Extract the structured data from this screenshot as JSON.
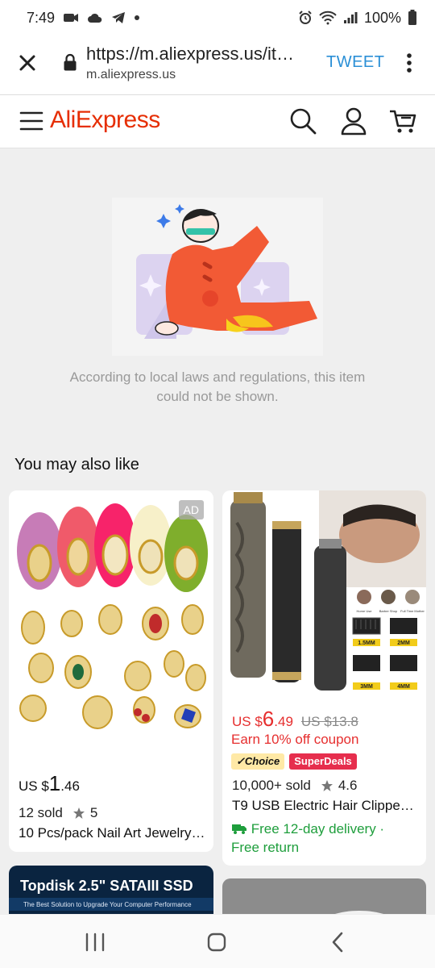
{
  "status_bar": {
    "time": "7:49",
    "battery": "100%"
  },
  "browser": {
    "url": "https://m.aliexpress.us/it…",
    "domain": "m.aliexpress.us",
    "action": "TWEET"
  },
  "header": {
    "logo": "AliExpress"
  },
  "notice": {
    "text": "According to local laws and regulations, this item could not be shown."
  },
  "recommendations": {
    "title": "You may also like",
    "products": [
      {
        "ad_label": "AD",
        "currency": "US $",
        "price_int": "1",
        "price_dec": ".46",
        "sold": "12 sold",
        "rating": "5",
        "title": "10 Pcs/pack Nail Art Jewelry…"
      },
      {
        "currency": "US $",
        "price_int": "6",
        "price_dec": ".49",
        "old_price": "US $13.8",
        "coupon": "Earn 10% off coupon",
        "badge_choice": "Choice",
        "badge_super": "SuperDeals",
        "sold": "10,000+ sold",
        "rating": "4.6",
        "title": "T9 USB Electric Hair Clipper…",
        "delivery": "Free 12-day delivery ·",
        "return": "Free return",
        "image_text": {
          "top_labels": [
            "Home Use",
            "Barber Shop",
            "Full Time Mother"
          ],
          "guards": [
            "1.5MM",
            "2MM",
            "3MM",
            "4MM"
          ]
        }
      },
      {
        "banner_title": "Topdisk 2.5\" SATAIII SSD",
        "banner_sub": "The Best Solution to Upgrade Your Computer Performance"
      }
    ]
  },
  "colors": {
    "brand": "#e62e04",
    "price_red": "#e62e2e",
    "delivery_green": "#1e9e3c",
    "tweet_blue": "#2a8fd6"
  }
}
